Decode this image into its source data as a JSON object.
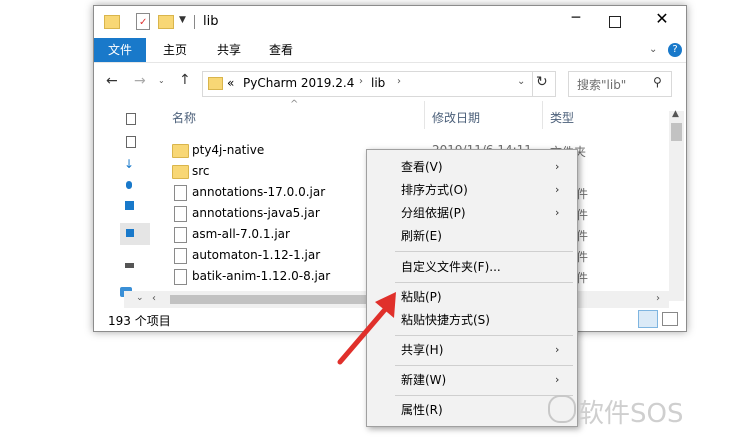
{
  "titlebar": {
    "path_label": "lib"
  },
  "ribbon": {
    "tabs": [
      "文件",
      "主页",
      "共享",
      "查看"
    ]
  },
  "address": {
    "prefix": "«",
    "crumbs": [
      "PyCharm 2019.2.4",
      "lib"
    ],
    "search_placeholder": "搜索\"lib\""
  },
  "columns": {
    "name": "名称",
    "date": "修改日期",
    "type": "类型"
  },
  "files": [
    {
      "name": "pty4j-native",
      "date": "2019/11/6 14:11",
      "type": "文件夹",
      "kind": "folder"
    },
    {
      "name": "src",
      "date": "",
      "type": "夹",
      "kind": "folder"
    },
    {
      "name": "annotations-17.0.0.jar",
      "date": "",
      "type": "文件",
      "kind": "file"
    },
    {
      "name": "annotations-java5.jar",
      "date": "",
      "type": "文件",
      "kind": "file"
    },
    {
      "name": "asm-all-7.0.1.jar",
      "date": "",
      "type": "文件",
      "kind": "file"
    },
    {
      "name": "automaton-1.12-1.jar",
      "date": "",
      "type": "文件",
      "kind": "file"
    },
    {
      "name": "batik-anim-1.12.0-8.jar",
      "date": "",
      "type": "文件",
      "kind": "file"
    }
  ],
  "status": {
    "count": "193 个项目"
  },
  "context_menu": {
    "items": [
      {
        "label": "查看(V)",
        "submenu": true
      },
      {
        "label": "排序方式(O)",
        "submenu": true
      },
      {
        "label": "分组依据(P)",
        "submenu": true
      },
      {
        "label": "刷新(E)",
        "submenu": false
      },
      {
        "label": "自定义文件夹(F)...",
        "submenu": false
      },
      {
        "label": "粘贴(P)",
        "submenu": false
      },
      {
        "label": "粘贴快捷方式(S)",
        "submenu": false
      },
      {
        "label": "共享(H)",
        "submenu": true
      },
      {
        "label": "新建(W)",
        "submenu": true
      },
      {
        "label": "属性(R)",
        "submenu": false
      }
    ]
  },
  "watermark": "软件SOS",
  "colors": {
    "accent": "#1979ca",
    "arrow": "#e0302b",
    "folder": "#f8d775"
  }
}
